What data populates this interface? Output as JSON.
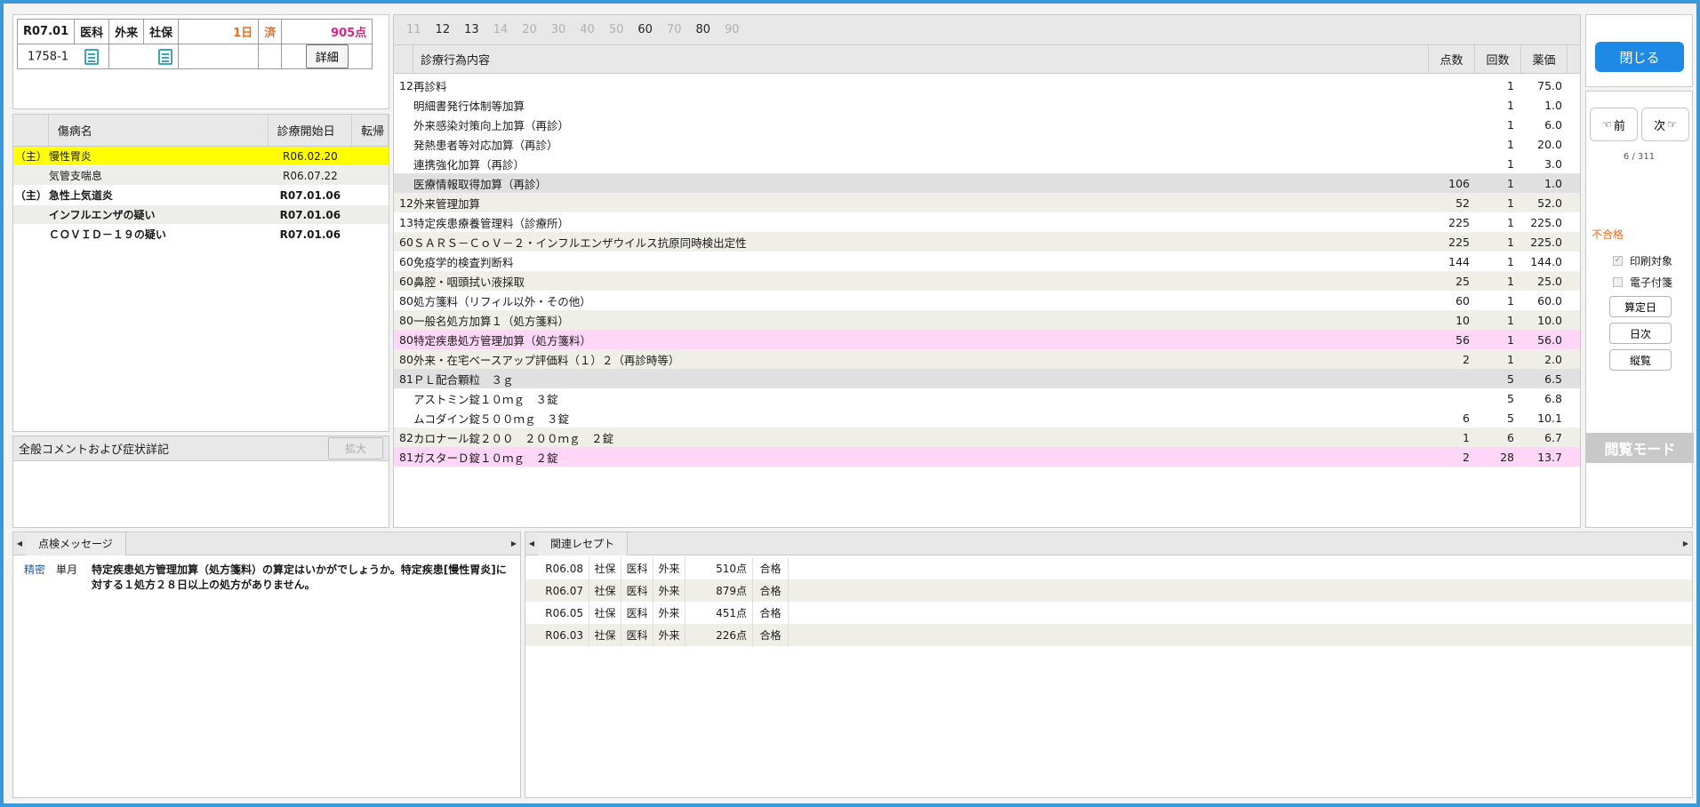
{
  "header": {
    "ym": "R07.01",
    "kind": "医科",
    "visit": "外来",
    "insurer": "社保",
    "days": "1日",
    "status": "済",
    "points": "905点",
    "record_id": "1758-1",
    "detail_label": "詳細"
  },
  "diseases": {
    "headers": [
      "傷病名",
      "診療開始日",
      "転帰"
    ],
    "rows": [
      {
        "main": "（主）",
        "name": "慢性胃炎",
        "date": "R06.02.20",
        "outcome": ""
      },
      {
        "main": "",
        "name": "気管支喘息",
        "date": "R06.07.22",
        "outcome": ""
      },
      {
        "main": "（主）",
        "name": "急性上気道炎",
        "date": "R07.01.06",
        "outcome": ""
      },
      {
        "main": "",
        "name": "インフルエンザの疑い",
        "date": "R07.01.06",
        "outcome": ""
      },
      {
        "main": "",
        "name": "ＣＯＶＩＤ－１９の疑い",
        "date": "R07.01.06",
        "outcome": ""
      }
    ]
  },
  "comment": {
    "title": "全般コメントおよび症状詳記",
    "expand_label": "拡大"
  },
  "main": {
    "tabs": [
      "11",
      "12",
      "13",
      "14",
      "20",
      "30",
      "40",
      "50",
      "60",
      "70",
      "80",
      "90"
    ],
    "active_tabs": [
      "12",
      "13",
      "60",
      "80"
    ],
    "headers": {
      "name": "診療行為内容",
      "points": "点数",
      "count": "回数",
      "price": "薬価"
    },
    "rows": [
      {
        "code": "12",
        "name": "再診料",
        "points": "",
        "count": "1",
        "price": "75.0",
        "style": ""
      },
      {
        "code": "",
        "name": "明細書発行体制等加算",
        "points": "",
        "count": "1",
        "price": "1.0",
        "style": ""
      },
      {
        "code": "",
        "name": "外来感染対策向上加算（再診）",
        "points": "",
        "count": "1",
        "price": "6.0",
        "style": ""
      },
      {
        "code": "",
        "name": "発熱患者等対応加算（再診）",
        "points": "",
        "count": "1",
        "price": "20.0",
        "style": ""
      },
      {
        "code": "",
        "name": "連携強化加算（再診）",
        "points": "",
        "count": "1",
        "price": "3.0",
        "style": ""
      },
      {
        "code": "",
        "name": "医療情報取得加算（再診）",
        "points": "106",
        "count": "1",
        "price": "1.0",
        "style": "gray"
      },
      {
        "code": "12",
        "name": "外来管理加算",
        "points": "52",
        "count": "1",
        "price": "52.0",
        "style": "alt"
      },
      {
        "code": "13",
        "name": "特定疾患療養管理料（診療所）",
        "points": "225",
        "count": "1",
        "price": "225.0",
        "style": ""
      },
      {
        "code": "60",
        "name": "ＳＡＲＳ－ＣｏＶ－２・インフルエンザウイルス抗原同時検出定性",
        "points": "225",
        "count": "1",
        "price": "225.0",
        "style": "alt"
      },
      {
        "code": "60",
        "name": "免疫学的検査判断料",
        "points": "144",
        "count": "1",
        "price": "144.0",
        "style": ""
      },
      {
        "code": "60",
        "name": "鼻腔・咽頭拭い液採取",
        "points": "25",
        "count": "1",
        "price": "25.0",
        "style": "alt"
      },
      {
        "code": "80",
        "name": "処方箋料（リフィル以外・その他）",
        "points": "60",
        "count": "1",
        "price": "60.0",
        "style": ""
      },
      {
        "code": "80",
        "name": "一般名処方加算１（処方箋料）",
        "points": "10",
        "count": "1",
        "price": "10.0",
        "style": "alt"
      },
      {
        "code": "80",
        "name": "特定疾患処方管理加算（処方箋料）",
        "points": "56",
        "count": "1",
        "price": "56.0",
        "style": "pink"
      },
      {
        "code": "80",
        "name": "外来・在宅ベースアップ評価料（１）２（再診時等）",
        "points": "2",
        "count": "1",
        "price": "2.0",
        "style": "alt"
      },
      {
        "code": "81",
        "name": "ＰＬ配合顆粒　３ｇ",
        "points": "",
        "count": "5",
        "price": "6.5",
        "style": "gray"
      },
      {
        "code": "",
        "name": "アストミン錠１０ｍｇ　３錠",
        "points": "",
        "count": "5",
        "price": "6.8",
        "style": ""
      },
      {
        "code": "",
        "name": "ムコダイン錠５００ｍｇ　３錠",
        "points": "6",
        "count": "5",
        "price": "10.1",
        "style": ""
      },
      {
        "code": "82",
        "name": "カロナール錠２００　２００ｍｇ　２錠",
        "points": "1",
        "count": "6",
        "price": "6.7",
        "style": "alt"
      },
      {
        "code": "81",
        "name": "ガスターＤ錠１０ｍｇ　２錠",
        "points": "2",
        "count": "28",
        "price": "13.7",
        "style": "pink"
      }
    ]
  },
  "side": {
    "close_label": "閉じる",
    "prev_label": "前",
    "next_label": "次",
    "pager": "6 / 311",
    "result": "不合格",
    "print_label": "印刷対象",
    "print_checked": "✓",
    "efusen_label": "電子付箋",
    "santei_label": "算定日",
    "nichiji_label": "日次",
    "jukan_label": "縦覧",
    "mode_label": "閲覧モード"
  },
  "check": {
    "tab_label": "点検メッセージ",
    "messages": [
      {
        "level": "精密",
        "scope": "単月",
        "text": "特定疾患処方管理加算（処方箋料）の算定はいかがでしょうか。特定疾患[慢性胃炎]に対する１処方２８日以上の処方がありません。"
      }
    ]
  },
  "related": {
    "tab_label": "関連レセプト",
    "rows": [
      {
        "ym": "R06.08",
        "ins": "社保",
        "kind": "医科",
        "visit": "外来",
        "points": "510点",
        "result": "合格"
      },
      {
        "ym": "R06.07",
        "ins": "社保",
        "kind": "医科",
        "visit": "外来",
        "points": "879点",
        "result": "合格"
      },
      {
        "ym": "R06.05",
        "ins": "社保",
        "kind": "医科",
        "visit": "外来",
        "points": "451点",
        "result": "合格"
      },
      {
        "ym": "R06.03",
        "ins": "社保",
        "kind": "医科",
        "visit": "外来",
        "points": "226点",
        "result": "合格"
      }
    ]
  },
  "colors": {
    "accent": "#1f8ae6",
    "highlight_yellow": "#ffff00",
    "highlight_pink": "#ffd6f7",
    "warning_orange": "#f26b1d",
    "points_pink": "#e0218a"
  }
}
